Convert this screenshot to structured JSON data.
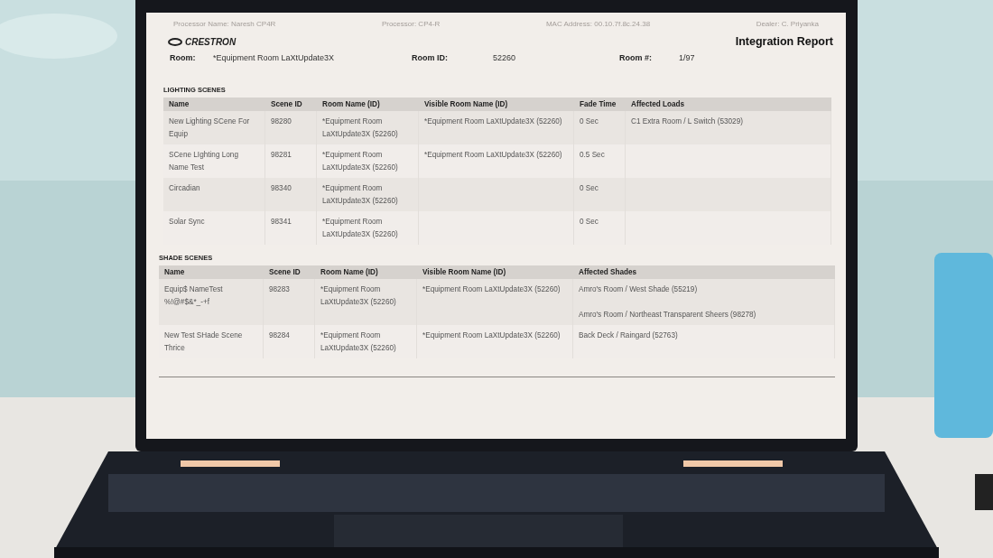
{
  "header": {
    "meta": [
      "Processor Name: Naresh CP4R",
      "Processor: CP4-R",
      "MAC Address: 00.10.7f.8c.24.38",
      "Dealer: C. Priyanka"
    ],
    "logo": "CRESTRON",
    "title": "Integration Report",
    "room_fields": [
      {
        "label": "Room:",
        "value": "*Equipment Room LaXtUpdate3X"
      },
      {
        "label": "Room ID:",
        "value": "52260"
      },
      {
        "label": "Room #:",
        "value": "1/97"
      }
    ]
  },
  "sections": [
    {
      "title": "LIGHTING SCENES",
      "columns": [
        "Name",
        "Scene ID",
        "Room Name (ID)",
        "Visible Room Name (ID)",
        "Fade Time",
        "Affected Loads"
      ],
      "rows": [
        [
          [
            "New Lighting SCene For Equip"
          ],
          [
            "98280"
          ],
          [
            "*Equipment Room LaXtUpdate3X (52260)"
          ],
          [
            "*Equipment Room LaXtUpdate3X  (52260)"
          ],
          [
            "0 Sec"
          ],
          [
            "C1 Extra Room  / L Switch (53029)"
          ]
        ],
        [
          [
            "SCene LIghting Long Name Test"
          ],
          [
            "98281"
          ],
          [
            "*Equipment Room LaXtUpdate3X (52260)"
          ],
          [
            "*Equipment Room LaXtUpdate3X  (52260)"
          ],
          [
            "0.5 Sec"
          ],
          []
        ],
        [
          [
            "Circadian"
          ],
          [
            "98340"
          ],
          [
            "*Equipment Room LaXtUpdate3X (52260)"
          ],
          [],
          [
            "0 Sec"
          ],
          []
        ],
        [
          [
            "Solar Sync"
          ],
          [
            "98341"
          ],
          [
            "*Equipment Room LaXtUpdate3X (52260)"
          ],
          [],
          [
            "0 Sec"
          ],
          []
        ]
      ]
    },
    {
      "title": "SHADE SCENES",
      "columns": [
        "Name",
        "Scene ID",
        "Room Name (ID)",
        "Visible Room Name (ID)",
        "Affected Shades"
      ],
      "rows": [
        [
          [
            "Equip$ NameTest %!@#$&*_-+f"
          ],
          [
            "98283"
          ],
          [
            "*Equipment Room LaXtUpdate3X (52260)"
          ],
          [
            "*Equipment Room LaXtUpdate3X  (52260)"
          ],
          [
            "Amro's Room / West Shade (55219)",
            "Amro's Room / Northeast Transparent Sheers (98278)"
          ]
        ],
        [
          [
            "New Test SHade Scene Thrice"
          ],
          [
            "98284"
          ],
          [
            "*Equipment Room LaXtUpdate3X (52260)"
          ],
          [
            "*Equipment Room LaXtUpdate3X  (52260)"
          ],
          [
            "Back Deck / Raingard (52763)"
          ]
        ]
      ]
    }
  ]
}
